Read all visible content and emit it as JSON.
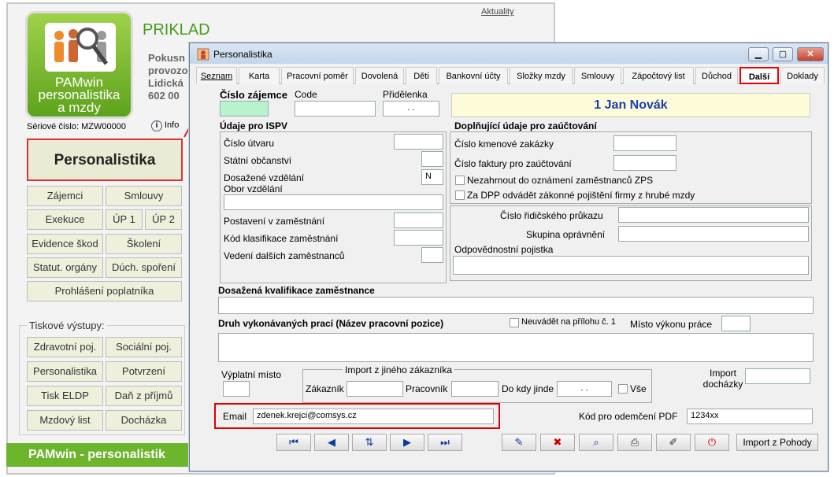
{
  "main": {
    "aktuality": "Aktuality",
    "logo_text": [
      "PAMwin",
      "personalistika",
      "a mzdy"
    ],
    "company_title": "PRIKLAD",
    "address": [
      "Pokusn",
      "provozo",
      "Lidická",
      "602 00"
    ],
    "serial": "Sériové číslo: MZW00000",
    "info": "Info",
    "big_button": "Personalistika",
    "buttons": [
      "Zájemci",
      "Smlouvy",
      "Exekuce",
      "ÚP 1",
      "ÚP 2",
      "Evidence škod",
      "Školení",
      "Statut. orgány",
      "Dúch. spoření",
      "Prohlášení poplatníka"
    ],
    "print_label": "Tiskové výstupy:",
    "print_buttons": [
      "Zdravotní poj.",
      "Sociální poj.",
      "Personalistika",
      "Potvrzení",
      "Tisk ELDP",
      "Daň z příjmů",
      "Mzdový list",
      "Docházka"
    ],
    "footer": "PAMwin - personalistik"
  },
  "dialog": {
    "title": "Personalistika",
    "tabs": [
      "Seznam",
      "Karta",
      "Pracovní poměr",
      "Dovolená",
      "Děti",
      "Bankovní účty",
      "Složky mzdy",
      "Smlouvy",
      "Zápočtový list",
      "Důchod",
      "Další",
      "Doklady"
    ],
    "cislo_zajemce": "Číslo zájemce",
    "code": "Code",
    "pridelenka": "Přidělenka",
    "pridelenka_value": ". .",
    "person": "1 Jan Novák",
    "isp_title": "Údaje pro ISPV",
    "cislo_utvaru": "Číslo útvaru",
    "statni_obcanstvi": "Státní občanství",
    "dosazene_vzdelani": "Dosažené vzdělání",
    "vzdelani_value": "N",
    "obor_vzdelani": "Obor vzdělání",
    "postaveni": "Postavení v zaměstnání",
    "kod_klasifikace": "Kód klasifikace zaměstnání",
    "vedeni": "Vedení dalších zaměstnanců",
    "dopl_title": "Doplňující údaje pro zaúčtování",
    "cislo_kmen": "Číslo kmenové zakázky",
    "cislo_faktury": "Číslo faktury pro zaúčtování",
    "nezahrnout": "Nezahrnout do oznámení zaměstnanců ZPS",
    "za_dpp": "Za DPP odvádět zákonné pojištění firmy z hrubé mzdy",
    "ridicak": "Číslo řidičského průkazu",
    "skupina": "Skupina oprávnění",
    "odpovednost": "Odpovědnostní pojistka",
    "kvalifikace": "Dosažená kvalifikace zaměstnance",
    "druh_praci": "Druh vykonávaných prací (Název pracovní pozice)",
    "neuvadet": "Neuvádět na přílohu č. 1",
    "misto_vykonu": "Místo výkonu práce",
    "vyplatni": "Výplatní místo",
    "import_group": "Import z jiného zákazníka",
    "zakaznik": "Zákazník",
    "pracovnik": "Pracovník",
    "do_kdy": "Do kdy jinde",
    "do_kdy_value": ". .",
    "vse": "Vše",
    "import_dochazky": "Import docházky",
    "email_label": "Email",
    "email_value": "zdenek.krejci@comsys.cz",
    "kod_pdf": "Kód pro odemčení PDF",
    "kod_pdf_value": "1234xx",
    "import_pohody": "Import z Pohody"
  }
}
